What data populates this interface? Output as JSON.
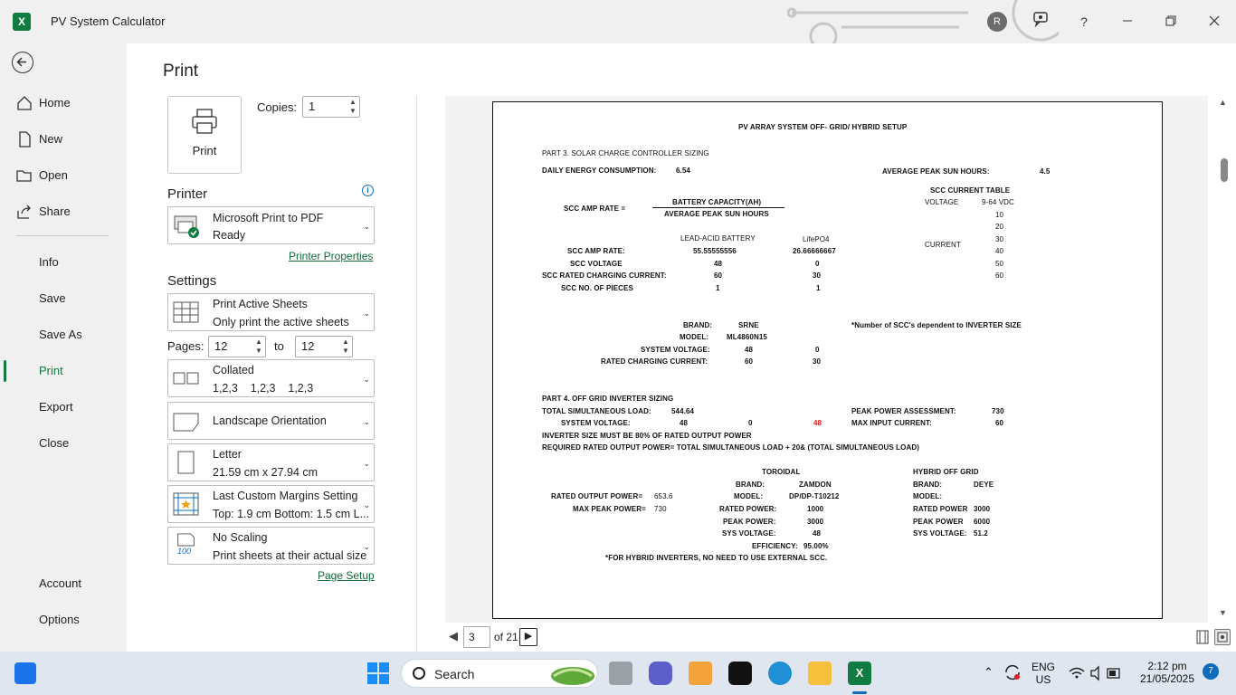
{
  "titlebar": {
    "app_title": "PV System Calculator",
    "avatar_initial": "R",
    "help": "?"
  },
  "nav": {
    "items": [
      {
        "label": "Home"
      },
      {
        "label": "New"
      },
      {
        "label": "Open"
      },
      {
        "label": "Share"
      },
      {
        "label": "Info"
      },
      {
        "label": "Save"
      },
      {
        "label": "Save As"
      },
      {
        "label": "Print"
      },
      {
        "label": "Export"
      },
      {
        "label": "Close"
      },
      {
        "label": "Account"
      },
      {
        "label": "Options"
      }
    ],
    "active": "Print"
  },
  "print": {
    "heading": "Print",
    "print_button": "Print",
    "copies_label": "Copies:",
    "copies_value": "1",
    "printer_heading": "Printer",
    "printer_name": "Microsoft Print to PDF",
    "printer_status": "Ready",
    "printer_properties": "Printer Properties",
    "settings_heading": "Settings",
    "sheets_main": "Print Active Sheets",
    "sheets_sub": "Only print the active sheets",
    "pages_label": "Pages:",
    "pages_from": "12",
    "to_label": "to",
    "pages_to": "12",
    "collated_main": "Collated",
    "collated_sub": "1,2,3    1,2,3    1,2,3",
    "orientation": "Landscape Orientation",
    "paper_main": "Letter",
    "paper_sub": "21.59 cm x 27.94 cm",
    "margins_main": "Last Custom Margins Setting",
    "margins_sub": "Top: 1.9 cm Bottom: 1.5 cm L...",
    "scaling_main": "No Scaling",
    "scaling_sub": "Print sheets at their actual size",
    "scaling_icon_text": "100",
    "page_setup": "Page Setup"
  },
  "pager": {
    "current": "3",
    "of_text": "of 21"
  },
  "sheet": {
    "title": "PV ARRAY SYSTEM OFF- GRID/ HYBRID SETUP",
    "part3": "PART 3. SOLAR CHARGE CONTROLLER SIZING",
    "daily_label": "DAILY ENERGY CONSUMPTION:",
    "daily_value": "6.54",
    "psh_label": "AVERAGE PEAK SUN HOURS:",
    "psh_value": "4.5",
    "scc_table_title": "SCC CURRENT TABLE",
    "voltage_label": "VOLTAGE",
    "voltage_value": "9-64 VDC",
    "current_label": "CURRENT",
    "current_values": [
      "10",
      "20",
      "30",
      "40",
      "50",
      "60"
    ],
    "scc_amp_formula_label": "SCC AMP RATE =",
    "formula_num": "BATTERY CAPACITY(AH)",
    "formula_den": "AVERAGE PEAK SUN HOURS",
    "col_lead": "LEAD-ACID BATTERY",
    "col_lifepo4": "LifePO4",
    "rows": [
      {
        "label": "SCC AMP RATE:",
        "lead": "55.55555556",
        "life": "26.66666667"
      },
      {
        "label": "SCC VOLTAGE",
        "lead": "48",
        "life": "0"
      },
      {
        "label": "SCC RATED CHARGING CURRENT:",
        "lead": "60",
        "life": "30"
      },
      {
        "label": "SCC NO. OF PIECES",
        "lead": "1",
        "life": "1"
      }
    ],
    "brand_label": "BRAND:",
    "brand_value": "SRNE",
    "model_label": "MODEL:",
    "model_value": "ML4860N15",
    "sysv_label": "SYSTEM VOLTAGE:",
    "sysv_a": "48",
    "sysv_b": "0",
    "rcc_label": "RATED CHARGING CURRENT:",
    "rcc_a": "60",
    "rcc_b": "30",
    "note_scc": "*Number of SCC's dependent to INVERTER SIZE",
    "part4": "PART 4. OFF GRID INVERTER SIZING",
    "tsl_label": "TOTAL SIMULTANEOUS LOAD:",
    "tsl_value": "544.64",
    "ppa_label": "PEAK POWER ASSESSMENT:",
    "ppa_value": "730",
    "sv_label": "SYSTEM VOLTAGE:",
    "sv_a": "48",
    "sv_b": "0",
    "sv_c": "48",
    "mic_label": "MAX INPUT CURRENT:",
    "mic_value": "60",
    "rule1": "INVERTER SIZE MUST BE 80% OF RATED OUTPUT POWER",
    "rule2": "REQUIRED RATED OUTPUT POWER= TOTAL SIMULTANEOUS LOAD + 20& (TOTAL SIMULTANEOUS LOAD)",
    "toroidal": "TOROIDAL",
    "hybrid": "HYBRID OFF GRID",
    "rop_label": "RATED OUTPUT POWER=",
    "rop_value": "653.6",
    "mpp_label": "MAX PEAK POWER=",
    "mpp_value": "730",
    "t_brand_l": "BRAND:",
    "t_brand_v": "ZAMDON",
    "t_model_l": "MODEL:",
    "t_model_v": "DP/DP-T10212",
    "t_rp_l": "RATED POWER:",
    "t_rp_v": "1000",
    "t_pp_l": "PEAK POWER:",
    "t_pp_v": "3000",
    "t_sv_l": "SYS VOLTAGE:",
    "t_sv_v": "48",
    "t_eff_l": "EFFICIENCY:",
    "t_eff_v": "95.00%",
    "h_brand_l": "BRAND:",
    "h_brand_v": "DEYE",
    "h_model_l": "MODEL:",
    "h_rp_l": "RATED POWER",
    "h_rp_v": "3000",
    "h_pp_l": "PEAK POWER",
    "h_pp_v": "6000",
    "h_sv_l": "SYS VOLTAGE:",
    "h_sv_v": "51.2",
    "note_hybrid": "*FOR HYBRID INVERTERS, NO NEED TO USE EXTERNAL SCC."
  },
  "taskbar": {
    "search": "Search",
    "lang1": "ENG",
    "lang2": "US",
    "time": "2:12 pm",
    "date": "21/05/2025",
    "notifications": "7"
  },
  "colors": {
    "excel_green": "#107c41",
    "link_green": "#0e6a3a",
    "accent_blue": "#0f6cbd",
    "highlight_red": "#e21c1c"
  }
}
